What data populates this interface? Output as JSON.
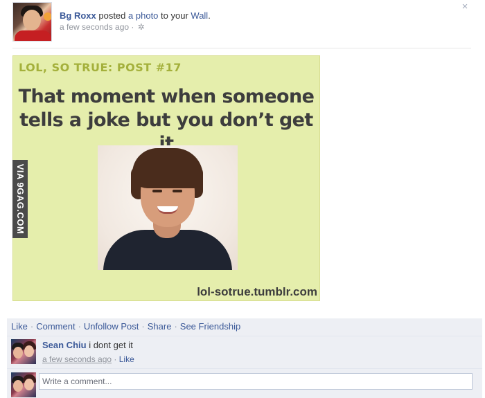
{
  "post": {
    "author": "Bg Roxx",
    "verb": "posted",
    "object": "a photo",
    "preposition": "to your",
    "target": "Wall",
    "target_suffix": ".",
    "timestamp": "a few seconds ago",
    "meta_separator": " · ",
    "close_glyph": "×",
    "gear_glyph": "✲"
  },
  "photo": {
    "series": "LOL, SO TRUE: POST #17",
    "caption": "That moment when someone tells a joke but you don’t get it",
    "source": "lol-sotrue.tumblr.com",
    "watermark": "VIA 9GAG.COM",
    "background_color": "#e5eeac"
  },
  "actions": {
    "items": [
      "Like",
      "Comment",
      "Unfollow Post",
      "Share",
      "See Friendship"
    ],
    "separator": "·"
  },
  "comments": [
    {
      "author": "Sean Chiu",
      "text": "i dont get it",
      "timestamp": "a few seconds ago",
      "separator": " · ",
      "like_label": "Like"
    }
  ],
  "compose": {
    "placeholder": "Write a comment..."
  },
  "colors": {
    "link": "#3b5998",
    "panel": "#edeff4",
    "meta": "#90949c"
  }
}
